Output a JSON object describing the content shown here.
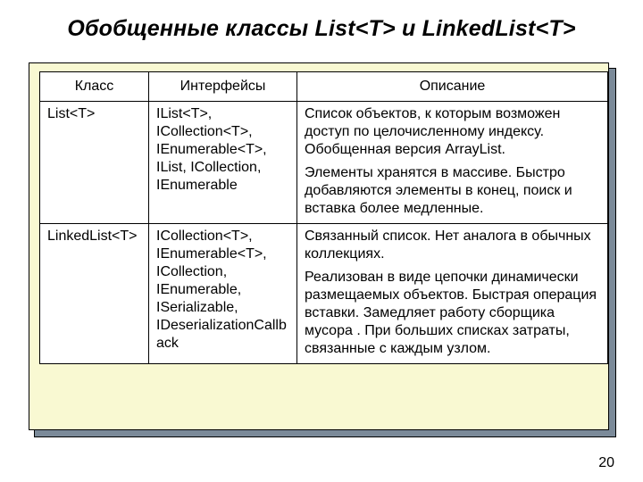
{
  "title": "Обобщенные классы List<T> и LinkedList<T>",
  "page_number": "20",
  "table": {
    "headers": {
      "class": "Класс",
      "interfaces": "Интерфейсы",
      "description": "Описание"
    },
    "rows": [
      {
        "class": "List<T>",
        "interfaces": "IList<T>, ICollection<T>, IEnumerable<T>, IList, ICollection, IEnumerable",
        "desc1": "Список объектов, к которым возможен доступ по целочисленному индексу. Обобщенная версия ArrayList.",
        "desc2": "Элементы хранятся в массиве. Быстро добавляются элементы в конец, поиск и вставка более медленные."
      },
      {
        "class": "LinkedList<T>",
        "interfaces": "ICollection<T>, IEnumerable<T>, ICollection, IEnumerable, ISerializable, IDeserializationCallback",
        "desc1": "Связанный список. Нет аналога в обычных коллекциях.",
        "desc2": "Реализован в виде цепочки динамически размещаемых объектов. Быстрая операция вставки. Замедляет работу сборщика мусора . При больших списках затраты, связанные с каждым узлом."
      }
    ]
  }
}
